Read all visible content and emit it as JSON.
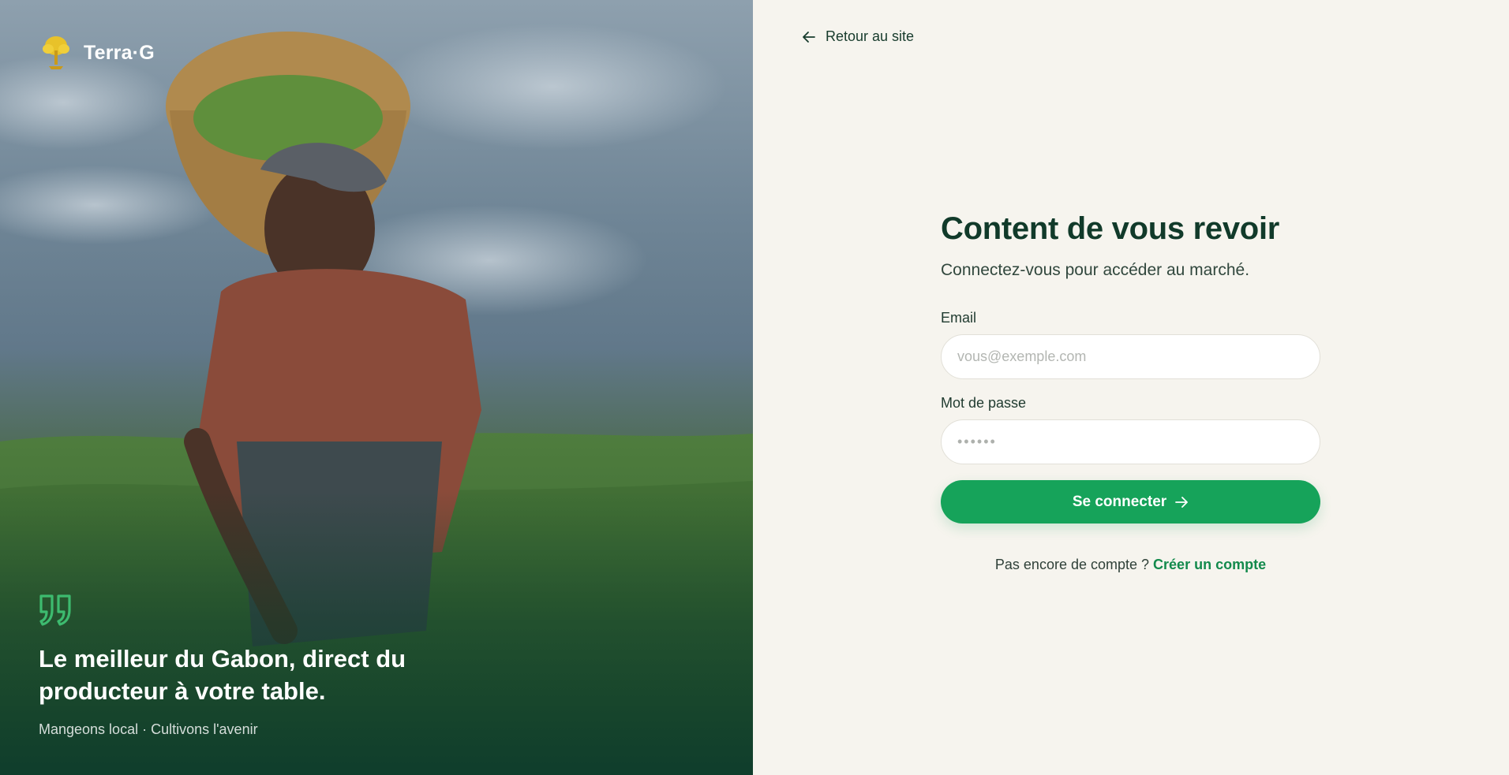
{
  "brand": {
    "name": "Terra·G"
  },
  "hero": {
    "quote": "Le meilleur du Gabon, direct du producteur à votre table.",
    "tagline": "Mangeons local · Cultivons l'avenir"
  },
  "nav": {
    "back_label": "Retour au site"
  },
  "login": {
    "title": "Content de vous revoir",
    "subtitle": "Connectez-vous pour accéder au marché.",
    "email_label": "Email",
    "email_placeholder": "vous@exemple.com",
    "email_value": "",
    "password_label": "Mot de passe",
    "password_placeholder": "••••••",
    "password_value": "",
    "submit_label": "Se connecter",
    "signup_prompt": "Pas encore de compte ?",
    "signup_link": "Créer un compte"
  },
  "icons": {
    "logo": "wheat-tree-logo-icon",
    "back": "arrow-left-icon",
    "submit": "arrow-right-icon",
    "quote": "quote-icon"
  },
  "colors": {
    "accent": "#16a35a",
    "accent_dark": "#138a4c",
    "heading": "#113a2a",
    "panel_bg": "#f6f4ee",
    "quote_icon": "#3dbb6f"
  }
}
